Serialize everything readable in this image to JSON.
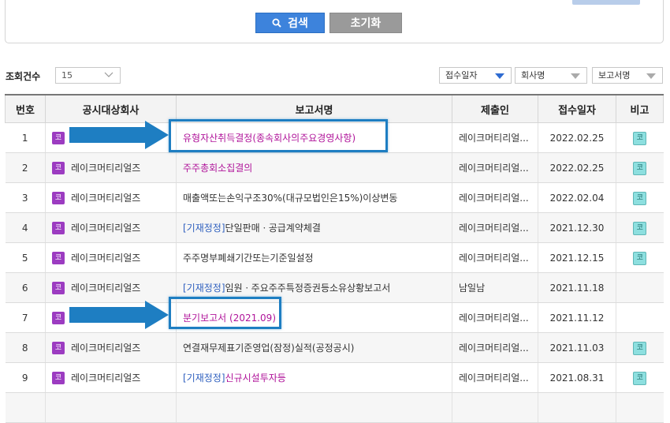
{
  "search_panel": {
    "search_label": "검색",
    "reset_label": "초기화"
  },
  "list_controls": {
    "count_label": "조회건수",
    "count_value": "15",
    "sort_options": [
      "접수일자",
      "회사명",
      "보고서명"
    ],
    "active_sort": "접수일자"
  },
  "table": {
    "headers": [
      "번호",
      "공시대상회사",
      "보고서명",
      "제출인",
      "접수일자",
      "비고"
    ],
    "rows": [
      {
        "no": "1",
        "market": "코",
        "company": "",
        "tag": "",
        "report": "유형자산취득결정(종속회사의주요경영사항)",
        "submitter": "레이크머티리얼...",
        "date": "2022.02.25",
        "note": "코"
      },
      {
        "no": "2",
        "market": "코",
        "company": "레이크머티리얼즈",
        "tag": "",
        "report": "주주총회소집결의",
        "submitter": "레이크머티리얼...",
        "date": "2022.02.25",
        "note": "코"
      },
      {
        "no": "3",
        "market": "코",
        "company": "레이크머티리얼즈",
        "tag": "",
        "report": "매출액또는손익구조30%(대규모법인은15%)이상변동",
        "submitter": "레이크머티리얼...",
        "date": "2022.02.04",
        "note": "코"
      },
      {
        "no": "4",
        "market": "코",
        "company": "레이크머티리얼즈",
        "tag": "[기재정정]",
        "report": "단일판매ㆍ공급계약체결",
        "submitter": "레이크머티리얼...",
        "date": "2021.12.30",
        "note": "코"
      },
      {
        "no": "5",
        "market": "코",
        "company": "레이크머티리얼즈",
        "tag": "",
        "report": "주주명부폐쇄기간또는기준일설정",
        "submitter": "레이크머티리얼...",
        "date": "2021.12.15",
        "note": "코"
      },
      {
        "no": "6",
        "market": "코",
        "company": "레이크머티리얼즈",
        "tag": "[기재정정]",
        "report": "임원ㆍ주요주주특정증권등소유상황보고서",
        "submitter": "남일남",
        "date": "2021.11.18",
        "note": ""
      },
      {
        "no": "7",
        "market": "코",
        "company": "",
        "tag": "",
        "report": "분기보고서 (2021.09)",
        "submitter": "레이크머티리얼...",
        "date": "2021.11.12",
        "note": ""
      },
      {
        "no": "8",
        "market": "코",
        "company": "레이크머티리얼즈",
        "tag": "",
        "report": "연결재무제표기준영업(잠정)실적(공정공시)",
        "submitter": "레이크머티리얼...",
        "date": "2021.11.03",
        "note": "코"
      },
      {
        "no": "9",
        "market": "코",
        "company": "레이크머티리얼즈",
        "tag": "[기재정정]",
        "report": "신규시설투자등",
        "submitter": "레이크머티리얼...",
        "date": "2021.08.31",
        "note": "코"
      }
    ]
  },
  "colors": {
    "accent": "#3d83dc",
    "highlight": "#1e7ec2",
    "market_badge": "#9c3cc1",
    "note_badge": "#8ddfdf",
    "link_pink": "#b0149a",
    "tag_blue": "#2e5fbe"
  },
  "icons": {
    "search": "search-icon",
    "dropdown": "chevron-down-icon",
    "sort": "triangle-down-icon",
    "annotation": "arrow-right-icon"
  }
}
